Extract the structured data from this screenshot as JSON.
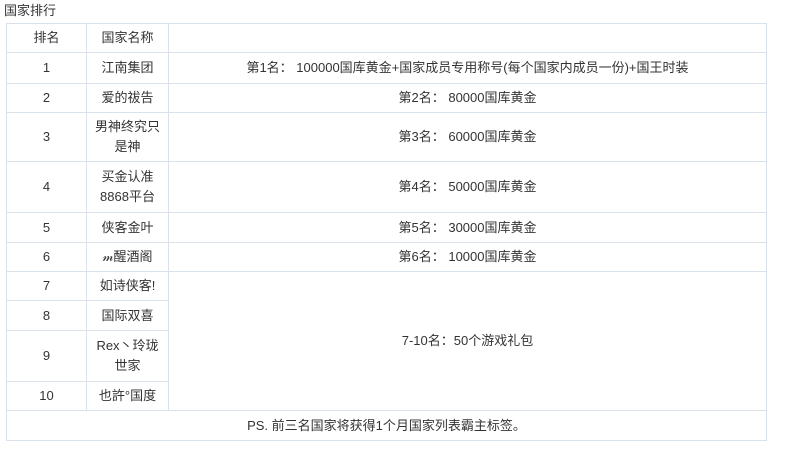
{
  "page": {
    "title": "国家排行"
  },
  "table": {
    "headers": [
      "排名",
      "国家名称",
      ""
    ],
    "rows": [
      {
        "rank": "1",
        "name": "江南集团",
        "reward": "第1名： 100000国库黄金+国家成员专用称号(每个国家内成员一份)+国王时装"
      },
      {
        "rank": "2",
        "name": "爱的祓告",
        "reward": "第2名： 80000国库黄金"
      },
      {
        "rank": "3",
        "name": "男神终究只是神",
        "reward": "第3名： 60000国库黄金"
      },
      {
        "rank": "4",
        "name": "买金认准8868平台",
        "reward": "第4名： 50000国库黄金"
      },
      {
        "rank": "5",
        "name": "侠客金叶",
        "reward": "第5名： 30000国库黄金"
      },
      {
        "rank": "6",
        "name": "𝓂醒酒阁",
        "reward": "第6名： 10000国库黄金"
      },
      {
        "rank": "7",
        "name": "如诗侠客!"
      },
      {
        "rank": "8",
        "name": "国际双喜"
      },
      {
        "rank": "9",
        "name": "Rex丶玲珑世家"
      },
      {
        "rank": "10",
        "name": "也許°国度"
      }
    ],
    "group_reward": "7-10名：50个游戏礼包",
    "footnote": "PS. 前三名国家将获得1个月国家列表霸主标签。"
  }
}
